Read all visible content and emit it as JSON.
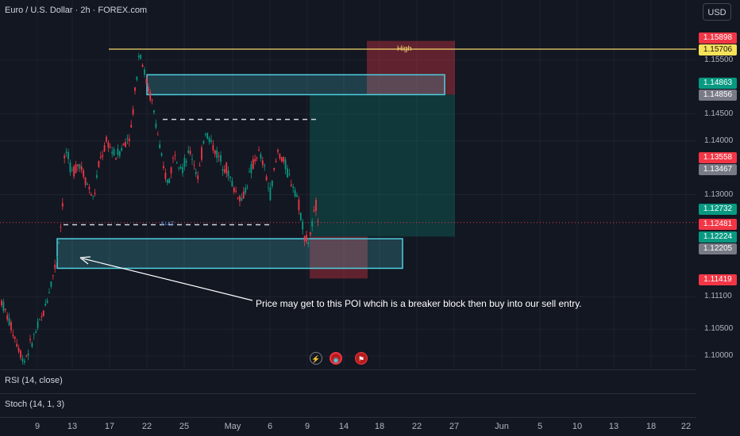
{
  "header": {
    "title": "Euro / U.S. Dollar · 2h · FOREX.com",
    "currency_button": "USD"
  },
  "price_tags": [
    {
      "value": "1.15898",
      "color": "#f23645"
    },
    {
      "value": "1.15706",
      "color": "#f7e158",
      "text_color": "#131722"
    },
    {
      "value": "1.14863",
      "color": "#089981"
    },
    {
      "value": "1.14856",
      "color": "#787b86"
    },
    {
      "value": "1.13558",
      "color": "#f23645"
    },
    {
      "value": "1.13467",
      "color": "#787b86"
    },
    {
      "value": "1.12732",
      "color": "#089981"
    },
    {
      "value": "1.12481",
      "color": "#f23645"
    },
    {
      "value": "1.12224",
      "color": "#089981"
    },
    {
      "value": "1.12205",
      "color": "#787b86"
    },
    {
      "value": "1.11419",
      "color": "#f23645"
    }
  ],
  "annotations": {
    "high_label": "High",
    "lkz_label": "5 LKZ",
    "note": "Price may get to this POI whcih is a breaker block then buy into our sell entry."
  },
  "panes": {
    "rsi_label": "RSI (14, close)",
    "stoch_label": "Stoch (14, 1, 3)"
  },
  "icons": [
    "lightning-icon",
    "target-icon",
    "flag-icon"
  ],
  "chart_data": {
    "type": "candlestick",
    "title": "Euro / U.S. Dollar · 2h · FOREX.com",
    "y_ticks": [
      "1.15500",
      "1.14500",
      "1.14000",
      "1.13000",
      "1.11100",
      "1.10500",
      "1.10000"
    ],
    "y_range": [
      1.098,
      1.162
    ],
    "x_ticks": [
      "9",
      "13",
      "17",
      "22",
      "25",
      "May",
      "6",
      "9",
      "14",
      "18",
      "22",
      "27",
      "Jun",
      "5",
      "10",
      "13",
      "18",
      "22"
    ],
    "levels": {
      "high_line": 1.15706,
      "last_price": 1.12481
    },
    "zones": [
      {
        "name": "supply-zone",
        "top": 1.1523,
        "bottom": 1.1486,
        "color": "#4dd0e1"
      },
      {
        "name": "breaker-block-poi",
        "top": 1.1218,
        "bottom": 1.1163,
        "color": "#4dd0e1"
      },
      {
        "name": "target-zone",
        "top": 1.1586,
        "bottom": 1.1486,
        "color": "#f23645"
      },
      {
        "name": "profit-zone",
        "top": 1.1486,
        "bottom": 1.1222,
        "color": "#089981"
      },
      {
        "name": "stop-zone",
        "top": 1.1222,
        "bottom": 1.1144,
        "color": "#f23645"
      }
    ],
    "dashed_levels": [
      {
        "name": "upper-dashed",
        "value": 1.144
      },
      {
        "name": "lkz-dashed",
        "value": 1.1244
      }
    ],
    "price_path": [
      [
        0,
        1.111
      ],
      [
        30,
        1.099
      ],
      [
        55,
        1.108
      ],
      [
        70,
        1.117
      ],
      [
        78,
        1.126
      ],
      [
        82,
        1.139
      ],
      [
        90,
        1.134
      ],
      [
        100,
        1.136
      ],
      [
        110,
        1.132
      ],
      [
        118,
        1.129
      ],
      [
        125,
        1.136
      ],
      [
        135,
        1.14
      ],
      [
        145,
        1.137
      ],
      [
        155,
        1.139
      ],
      [
        165,
        1.142
      ],
      [
        172,
        1.152
      ],
      [
        176,
        1.1575
      ],
      [
        180,
        1.154
      ],
      [
        186,
        1.15
      ],
      [
        192,
        1.147
      ],
      [
        198,
        1.142
      ],
      [
        205,
        1.135
      ],
      [
        212,
        1.132
      ],
      [
        220,
        1.138
      ],
      [
        230,
        1.135
      ],
      [
        240,
        1.138
      ],
      [
        250,
        1.133
      ],
      [
        258,
        1.142
      ],
      [
        265,
        1.14
      ],
      [
        275,
        1.137
      ],
      [
        285,
        1.135
      ],
      [
        295,
        1.131
      ],
      [
        305,
        1.129
      ],
      [
        315,
        1.134
      ],
      [
        325,
        1.138
      ],
      [
        333,
        1.135
      ],
      [
        340,
        1.13
      ],
      [
        350,
        1.138
      ],
      [
        358,
        1.136
      ],
      [
        365,
        1.133
      ],
      [
        372,
        1.131
      ],
      [
        378,
        1.127
      ],
      [
        384,
        1.1222
      ],
      [
        388,
        1.121
      ],
      [
        393,
        1.124
      ],
      [
        398,
        1.128
      ],
      [
        402,
        1.1248
      ]
    ]
  }
}
